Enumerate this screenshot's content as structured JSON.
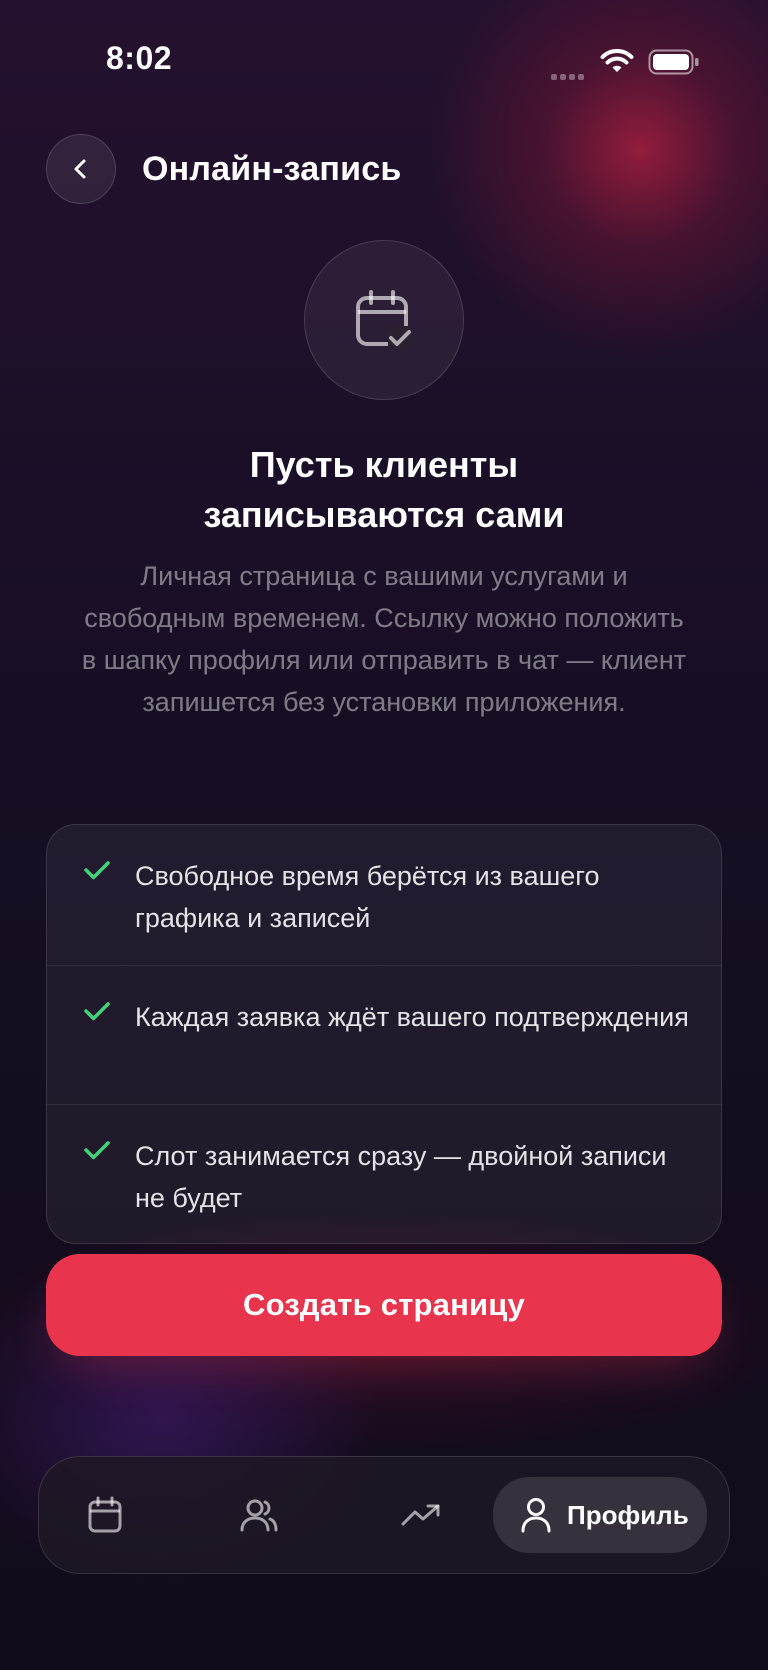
{
  "status_bar": {
    "time": "8:02"
  },
  "header": {
    "back_icon": "chevron-left-icon",
    "title": "Онлайн-запись"
  },
  "hero": {
    "icon": "calendar-check-icon",
    "title_line1": "Пусть клиенты",
    "title_line2": "записываются сами",
    "description": "Личная страница с вашими услугами и свободным временем. Ссылку можно положить в шапку профиля или отправить в чат — клиент запишется без установки приложения."
  },
  "features": [
    {
      "icon": "check-icon",
      "text": "Свободное время берётся из вашего графика и записей"
    },
    {
      "icon": "check-icon",
      "text": "Каждая заявка ждёт вашего подтверждения"
    },
    {
      "icon": "check-icon",
      "text": "Слот занимается сразу — двойной записи не будет"
    }
  ],
  "cta": {
    "label": "Создать страницу"
  },
  "tab_bar": {
    "items": [
      {
        "icon": "calendar-icon",
        "label": ""
      },
      {
        "icon": "users-icon",
        "label": ""
      },
      {
        "icon": "trending-up-icon",
        "label": ""
      },
      {
        "icon": "user-icon",
        "label": "Профиль",
        "active": true
      }
    ]
  },
  "colors": {
    "accent": "#e8344d",
    "check": "#3fd37a",
    "background": "#150d20"
  }
}
